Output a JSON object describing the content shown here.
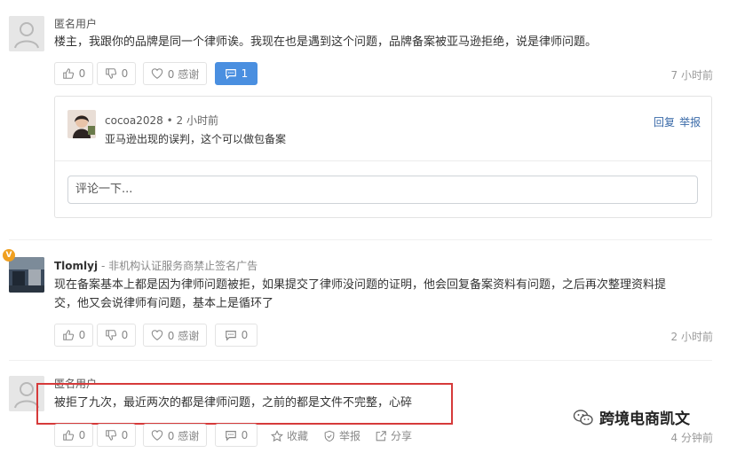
{
  "comment1": {
    "username": "匿名用户",
    "text": "楼主，我跟你的品牌是同一个律师诶。我现在也是遇到这个问题，品牌备案被亚马逊拒绝，说是律师问题。",
    "like_count": "0",
    "dislike_count": "0",
    "thanks_label": "0 感谢",
    "reply_count": "1",
    "time": "7 小时前",
    "reply": {
      "username": "cocoa2028",
      "meta": "• 2 小时前",
      "text": "亚马逊出现的误判，这个可以做包备案",
      "reply_link": "回复",
      "report_link": "举报"
    },
    "comment_placeholder": "评论一下..."
  },
  "comment2": {
    "badge": "V",
    "username": "Tlomlyj",
    "tagline": "- 非机构认证服务商禁止签名广告",
    "text_line1": "现在备案基本上都是因为律师问题被拒，如果提交了律师没问题的证明，他会回复备案资料有问题，之后再次整理资料提",
    "text_line2": "交，他又会说律师有问题，基本上是循环了",
    "like_count": "0",
    "dislike_count": "0",
    "thanks_label": "0 感谢",
    "comment_count": "0",
    "time": "2 小时前"
  },
  "comment3": {
    "username": "匿名用户",
    "text": "被拒了九次，最近两次的都是律师问题，之前的都是文件不完整，心碎",
    "like_count": "0",
    "dislike_count": "0",
    "thanks_label": "0 感谢",
    "comment_count": "0",
    "favorite_label": "收藏",
    "report_label": "举报",
    "share_label": "分享",
    "time": "4 分钟前"
  },
  "watermark": {
    "text": "跨境电商凯文"
  },
  "colors": {
    "accent_blue": "#4a8fe0",
    "highlight_red": "#d63a3a",
    "badge_orange": "#f0a020"
  }
}
